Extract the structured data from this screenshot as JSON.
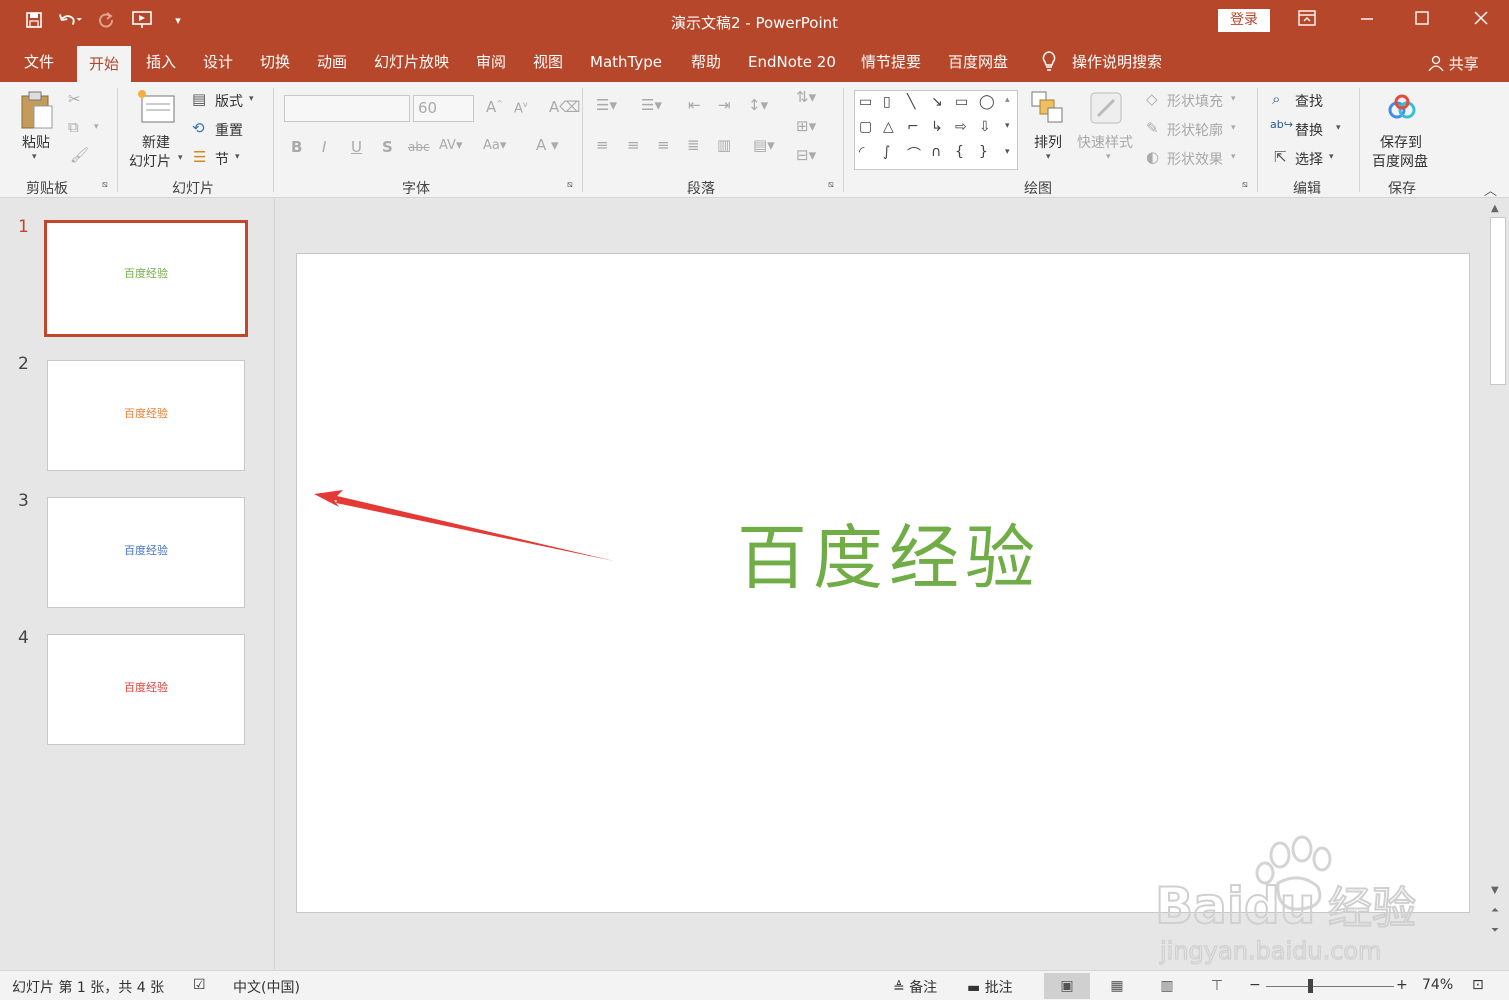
{
  "window": {
    "title": "演示文稿2  -  PowerPoint",
    "login_label": "登录",
    "theme_color": "#b7472a"
  },
  "qat": [
    "save-icon",
    "undo-icon",
    "redo-icon",
    "present-from-start-icon",
    "customize-qat-icon"
  ],
  "tabs": [
    {
      "label": "文件",
      "active": false
    },
    {
      "label": "开始",
      "active": true
    },
    {
      "label": "插入",
      "active": false
    },
    {
      "label": "设计",
      "active": false
    },
    {
      "label": "切换",
      "active": false
    },
    {
      "label": "动画",
      "active": false
    },
    {
      "label": "幻灯片放映",
      "active": false
    },
    {
      "label": "审阅",
      "active": false
    },
    {
      "label": "视图",
      "active": false
    },
    {
      "label": "MathType",
      "active": false
    },
    {
      "label": "帮助",
      "active": false
    },
    {
      "label": "EndNote 20",
      "active": false
    },
    {
      "label": "情节提要",
      "active": false
    },
    {
      "label": "百度网盘",
      "active": false
    }
  ],
  "tell_me": "操作说明搜索",
  "share_label": "共享",
  "ribbon": {
    "clipboard": {
      "paste": "粘贴",
      "group": "剪贴板"
    },
    "slides": {
      "new_line1": "新建",
      "new_line2": "幻灯片",
      "layout": "版式",
      "reset": "重置",
      "section": "节",
      "group": "幻灯片"
    },
    "font": {
      "name_value": "",
      "size_value": "60",
      "group": "字体"
    },
    "paragraph": {
      "group": "段落"
    },
    "drawing": {
      "arrange": "排列",
      "quick_styles": "快速样式",
      "shape_fill": "形状填充",
      "shape_outline": "形状轮廓",
      "shape_effects": "形状效果",
      "group": "绘图"
    },
    "editing": {
      "find": "查找",
      "replace": "替换",
      "select": "选择",
      "group": "编辑"
    },
    "save": {
      "line1": "保存到",
      "line2": "百度网盘",
      "group": "保存"
    }
  },
  "slides": [
    {
      "number": "1",
      "text": "百度经验",
      "color": "#70ad47",
      "selected": true
    },
    {
      "number": "2",
      "text": "百度经验",
      "color": "#ed7d31",
      "selected": false
    },
    {
      "number": "3",
      "text": "百度经验",
      "color": "#4472c4",
      "selected": false
    },
    {
      "number": "4",
      "text": "百度经验",
      "color": "#e0403b",
      "selected": false
    }
  ],
  "current_slide": {
    "text": "百度经验",
    "color": "#70ad47"
  },
  "annotation_arrow_color": "#e53935",
  "status": {
    "slide_info": "幻灯片 第 1 张，共 4 张",
    "language": "中文(中国)",
    "notes": "备注",
    "comments": "批注",
    "zoom": "74%"
  },
  "watermark": {
    "brand": "Baidu",
    "product": "经验",
    "url": "jingyan.baidu.com"
  }
}
